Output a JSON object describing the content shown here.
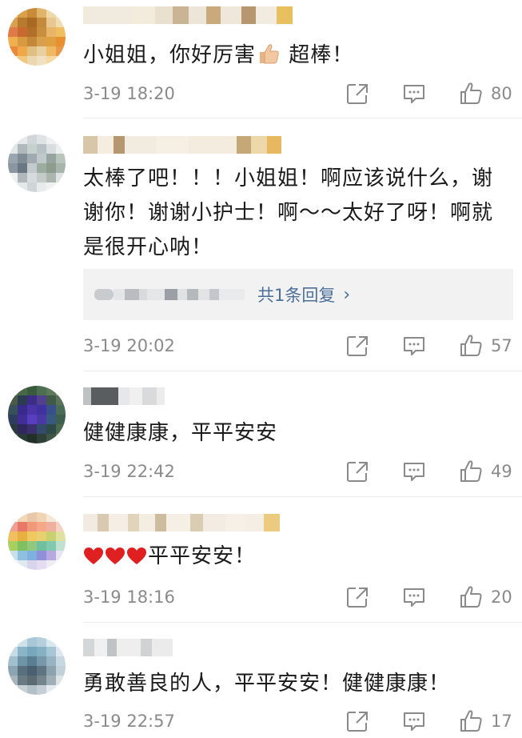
{
  "comments": [
    {
      "text": "小姐姐，你好厉害",
      "text_suffix": "超棒！",
      "emoji": "thumbs-up",
      "time": "3-19 18:20",
      "likes": "80"
    },
    {
      "text": "太棒了吧！！！小姐姐！啊应该说什么，谢谢你！谢谢小护士！啊～～太好了呀！啊就是很开心呐！",
      "reply_link": "共1条回复",
      "time": "3-19 20:02",
      "likes": "57"
    },
    {
      "text": "健健康康，平平安安",
      "time": "3-19 22:42",
      "likes": "49"
    },
    {
      "text": "平平安安！",
      "emoji": "red-heart",
      "time": "3-19 18:16",
      "likes": "20"
    },
    {
      "text": "勇敢善良的人，平平安安！健健康康！",
      "time": "3-19 22:57",
      "likes": "17"
    }
  ],
  "colors": {
    "link": "#4b6e9a",
    "meta": "#8a8a8a",
    "reply_bg": "#f2f2f2"
  },
  "icons": [
    "share-icon",
    "comment-icon",
    "like-icon"
  ]
}
